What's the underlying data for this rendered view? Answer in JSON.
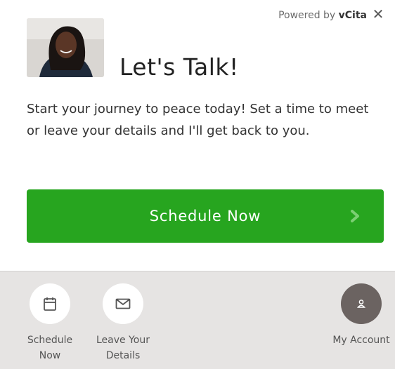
{
  "header": {
    "powered_by_prefix": "Powered by ",
    "powered_by_brand": "vCita",
    "close_glyph": "✕"
  },
  "widget": {
    "title": "Let's Talk!",
    "description": "Start your journey to peace today! Set a time to meet or leave your details and I'll get back to you.",
    "primary_button": "Schedule Now"
  },
  "footer": {
    "items": [
      {
        "label_line1": "Schedule",
        "label_line2": "Now",
        "icon": "calendar-icon"
      },
      {
        "label_line1": "Leave Your",
        "label_line2": "Details",
        "icon": "envelope-icon"
      },
      {
        "label_line1": "My Account",
        "label_line2": "",
        "icon": "user-icon"
      }
    ]
  },
  "colors": {
    "primary_green": "#27a51f",
    "footer_bg": "#e6e4e3",
    "account_circle": "#6b6361"
  }
}
